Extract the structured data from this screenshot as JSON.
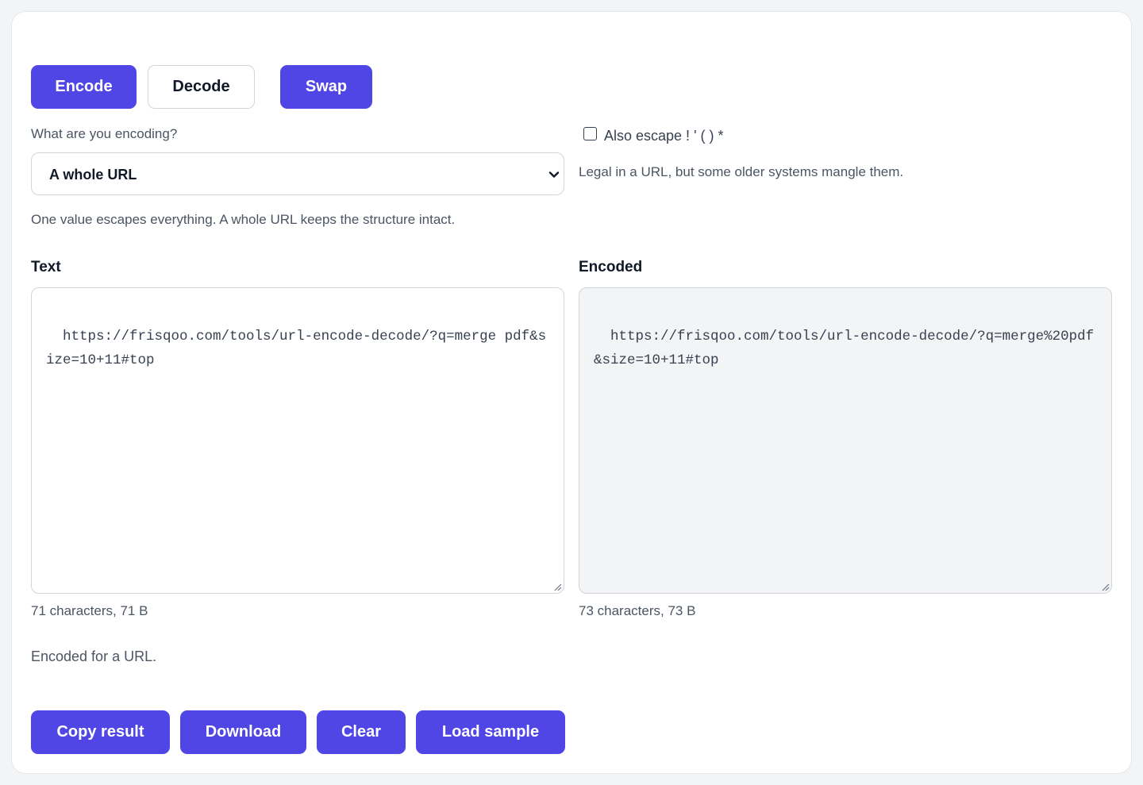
{
  "mode_buttons": {
    "encode": "Encode",
    "decode": "Decode",
    "swap": "Swap"
  },
  "options": {
    "encoding_label": "What are you encoding?",
    "select_value": "A whole URL",
    "select_hint": "One value escapes everything. A whole URL keeps the structure intact.",
    "escape_checkbox_label": "Also escape ! ' ( ) *",
    "escape_checked": false,
    "escape_hint": "Legal in a URL, but some older systems mangle them."
  },
  "input": {
    "label": "Text",
    "value": "https://frisqoo.com/tools/url-encode-decode/?q=merge pdf&size=10+11#top",
    "stats": "71 characters, 71 B"
  },
  "output": {
    "label": "Encoded",
    "value": "https://frisqoo.com/tools/url-encode-decode/?q=merge%20pdf&size=10+11#top",
    "stats": "73 characters, 73 B"
  },
  "status_message": "Encoded for a URL.",
  "actions": {
    "copy": "Copy result",
    "download": "Download",
    "clear": "Clear",
    "load_sample": "Load sample"
  },
  "colors": {
    "accent": "#4f46e5",
    "output_bg": "#f3f4f6",
    "muted_text": "#4b5563"
  },
  "icons": {
    "select_chevron": "chevron-down-icon",
    "resize": "resize-grip-icon"
  }
}
